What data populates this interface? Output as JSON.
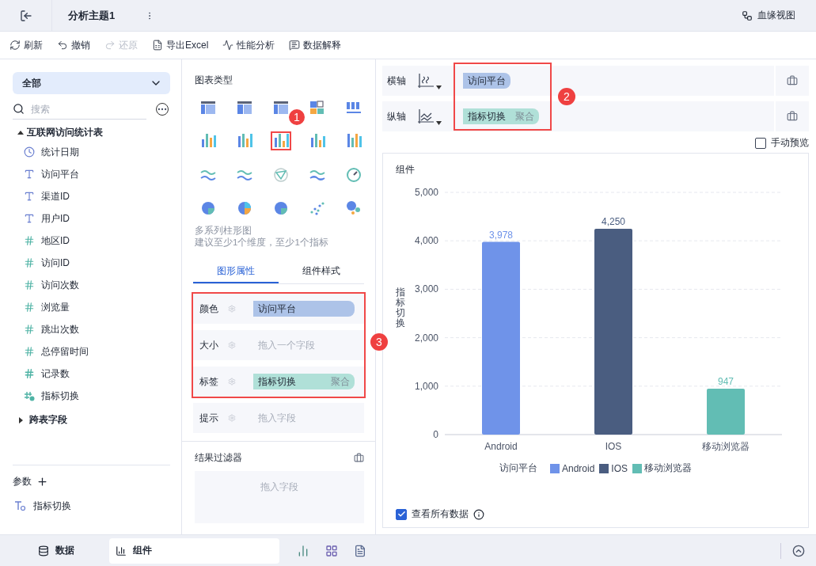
{
  "header": {
    "title": "分析主题1",
    "lineage": "血缘视图"
  },
  "toolbar": [
    {
      "label": "刷新",
      "kind": "refresh",
      "disabled": false
    },
    {
      "label": "撤销",
      "kind": "undo",
      "disabled": false
    },
    {
      "label": "还原",
      "kind": "redo",
      "disabled": true
    },
    {
      "label": "导出Excel",
      "kind": "excel",
      "disabled": false
    },
    {
      "label": "性能分析",
      "kind": "perf",
      "disabled": false
    },
    {
      "label": "数据解释",
      "kind": "explain",
      "disabled": false
    }
  ],
  "data_panel": {
    "scope": "全部",
    "search_placeholder": "搜索",
    "tree": [
      {
        "label": "互联网访问统计表",
        "expanded": true,
        "children": [
          {
            "label": "统计日期",
            "kind": "date"
          },
          {
            "label": "访问平台",
            "kind": "text"
          },
          {
            "label": "渠道ID",
            "kind": "text"
          },
          {
            "label": "用户ID",
            "kind": "text"
          },
          {
            "label": "地区ID",
            "kind": "number"
          },
          {
            "label": "访问ID",
            "kind": "number"
          },
          {
            "label": "访问次数",
            "kind": "number"
          },
          {
            "label": "浏览量",
            "kind": "number"
          },
          {
            "label": "跳出次数",
            "kind": "number"
          },
          {
            "label": "总停留时间",
            "kind": "number"
          },
          {
            "label": "记录数",
            "kind": "count"
          },
          {
            "label": "指标切换",
            "kind": "switch"
          }
        ]
      },
      {
        "label": "跨表字段",
        "expanded": false
      }
    ],
    "params_title": "参数",
    "params": [
      {
        "label": "指标切换",
        "kind": "param"
      }
    ]
  },
  "chart_types": {
    "title": "图表类型",
    "items": [
      {
        "selected": false
      },
      {
        "selected": false
      },
      {
        "selected": false
      },
      {
        "selected": false
      },
      {
        "selected": false
      },
      {
        "selected": false
      },
      {
        "selected": false
      },
      {
        "selected": true
      },
      {
        "selected": false
      },
      {
        "selected": false
      },
      {
        "selected": false
      },
      {
        "selected": false
      },
      {
        "selected": false
      },
      {
        "selected": false
      },
      {
        "selected": false
      },
      {
        "selected": false
      },
      {
        "selected": false
      },
      {
        "selected": false
      },
      {
        "selected": false
      },
      {
        "selected": false
      }
    ],
    "name": "多系列柱形图",
    "hint": "建议至少1个维度，至少1个指标"
  },
  "tabs": [
    {
      "label": "图形属性",
      "selected": true
    },
    {
      "label": "组件样式",
      "selected": false
    }
  ],
  "properties": [
    {
      "label": "颜色",
      "chip": {
        "text": "访问平台",
        "kind": "dimension"
      }
    },
    {
      "label": "大小",
      "placeholder": "拖入一个字段"
    },
    {
      "label": "标签",
      "chip": {
        "text": "指标切换",
        "suffix": "聚合",
        "kind": "measure"
      }
    },
    {
      "label": "提示",
      "placeholder": "拖入字段"
    }
  ],
  "filter": {
    "title": "结果过滤器",
    "placeholder": "拖入字段"
  },
  "axes": [
    {
      "label": "横轴",
      "chip": {
        "text": "访问平台",
        "kind": "dimension"
      }
    },
    {
      "label": "纵轴",
      "chip": {
        "text": "指标切换",
        "suffix": "聚合",
        "kind": "measure"
      }
    }
  ],
  "manual_preview": {
    "label": "手动预览",
    "checked": false
  },
  "component": {
    "title": "组件",
    "chart_data": {
      "type": "bar",
      "ylabel": "指标切换",
      "categories": [
        "Android",
        "IOS",
        "移动浏览器"
      ],
      "values": [
        3978,
        4250,
        947
      ],
      "grid": true,
      "ylim": [
        0,
        5000
      ],
      "yticks": [
        {
          "value": 0,
          "label": "0"
        },
        {
          "value": 1000,
          "label": "1,000"
        },
        {
          "value": 2000,
          "label": "2,000"
        },
        {
          "value": 3000,
          "label": "3,000"
        },
        {
          "value": 4000,
          "label": "4,000"
        },
        {
          "value": 5000,
          "label": "5,000"
        }
      ],
      "value_labels": [
        "3,978",
        "4,250",
        "947"
      ]
    },
    "legend": {
      "title": "访问平台",
      "items": [
        {
          "label": "Android",
          "color": "#6f93e9"
        },
        {
          "label": "IOS",
          "color": "#4a5d80"
        },
        {
          "label": "移动浏览器",
          "color": "#62bdb4"
        }
      ]
    },
    "view_all": {
      "label": "查看所有数据",
      "checked": true
    }
  },
  "annotations": [
    "1",
    "2",
    "3"
  ],
  "bottom_tabs": [
    {
      "label": "数据",
      "kind": "data",
      "selected": false
    },
    {
      "label": "组件",
      "kind": "component",
      "selected": true
    }
  ]
}
